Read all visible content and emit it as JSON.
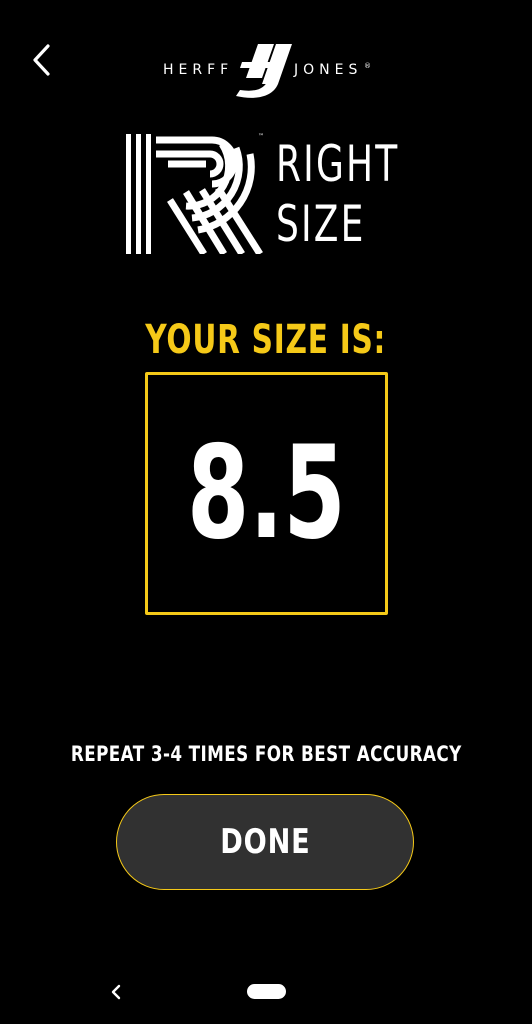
{
  "header": {
    "brand_left": "HERFF",
    "brand_right": "JONES",
    "brand_reg": "®",
    "back_icon": "chevron-left-icon"
  },
  "logo": {
    "line1": "RIGHT",
    "line2": "SIZE",
    "trademark": "™"
  },
  "result": {
    "label": "YOUR SIZE IS:",
    "value": "8.5"
  },
  "instruction": "REPEAT 3-4 TIMES FOR BEST ACCURACY",
  "actions": {
    "done_label": "DONE"
  },
  "nav": {
    "back_icon": "nav-back-icon",
    "home_icon": "nav-home-pill"
  },
  "colors": {
    "background": "#000000",
    "accent": "#f5c918",
    "button": "#313131",
    "text": "#ffffff"
  }
}
